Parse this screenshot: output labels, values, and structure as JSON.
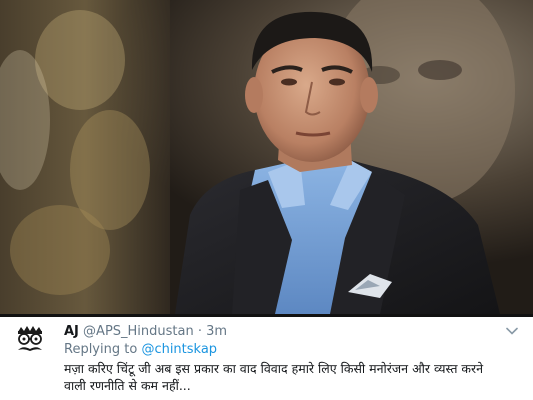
{
  "tweet": {
    "name": "AJ",
    "handle": "@APS_Hindustan",
    "separator": "·",
    "time": "3m",
    "reply_prefix": "Replying to",
    "reply_handle": "@chintskap",
    "text": "मज़ा करिए चिंटू जी अब इस प्रकार का वाद विवाद हमारे लिए किसी मनोरंजन और व्यस्त करने वाली रणनीति से कम नहीं..."
  },
  "icons": {
    "avatar": "mustache-glasses-avatar-icon",
    "menu": "chevron-down-icon"
  },
  "colors": {
    "link": "#1b95e0",
    "secondary_text": "#657786",
    "primary_text": "#14171a",
    "shirt": "#7aa6d9",
    "suit": "#1f1f22"
  }
}
